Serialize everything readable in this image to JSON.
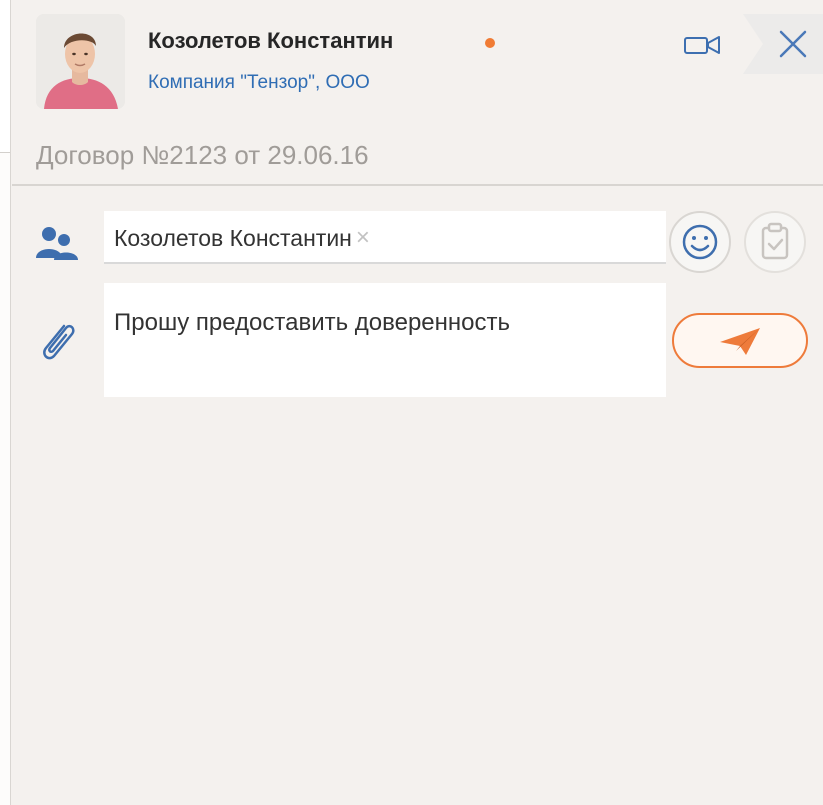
{
  "header": {
    "contact_name": "Козолетов Константин",
    "company": "Компания \"Тензор\", ООО",
    "status_color": "#f07b34",
    "icons": {
      "video": "video-camera-icon",
      "close": "close-icon"
    }
  },
  "thread": {
    "subject": "Договор №2123 от 29.06.16"
  },
  "composer": {
    "recipients": [
      {
        "label": "Козолетов Константин"
      }
    ],
    "chip_remove_glyph": "×",
    "message_text": "Прошу предоставить доверенность",
    "icons": {
      "recipients": "contacts-icon",
      "attach": "paperclip-icon",
      "emoji": "smiley-icon",
      "task": "clipboard-icon",
      "send": "paper-plane-icon"
    },
    "accent_color": "#ee7b3b"
  }
}
